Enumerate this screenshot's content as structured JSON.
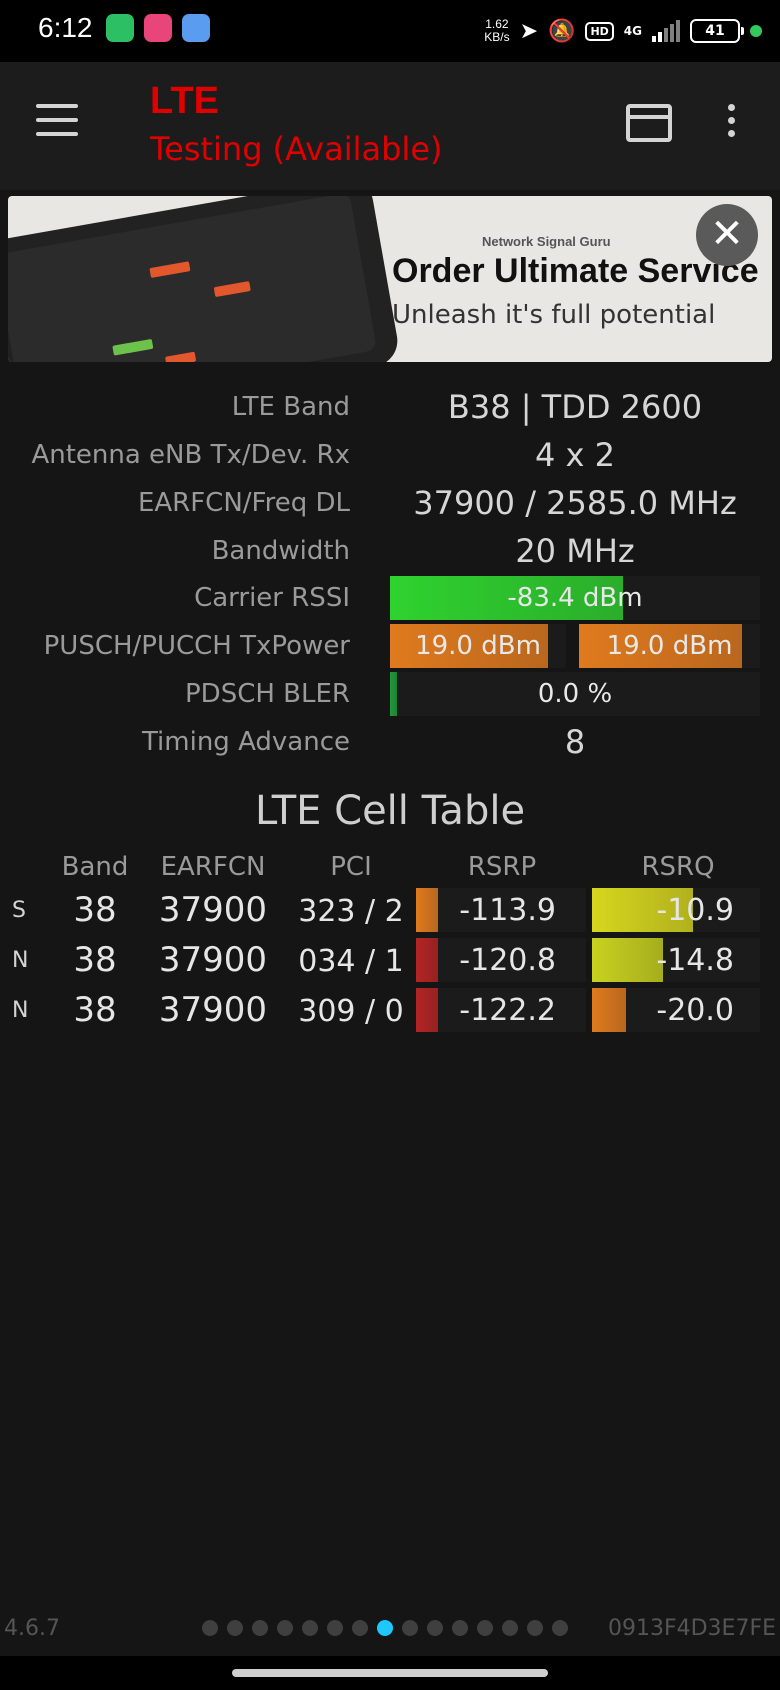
{
  "status_bar": {
    "time": "6:12",
    "speed_value": "1.62",
    "speed_unit": "KB/s",
    "hd": "HD",
    "network": "4G",
    "battery": "41",
    "icons": [
      "location-arrow-icon",
      "bell-off-icon",
      "signal-icon"
    ]
  },
  "app_bar": {
    "title": "LTE",
    "subtitle": "Testing (Available)"
  },
  "ad": {
    "small": "Network Signal Guru",
    "headline": "Order Ultimate Service",
    "tagline": "Unleash it's full potential",
    "close": "✕"
  },
  "info": [
    {
      "label": "LTE Band",
      "value": "B38 | TDD 2600"
    },
    {
      "label": "Antenna eNB Tx/Dev. Rx",
      "value": "4 x 2"
    },
    {
      "label": "EARFCN/Freq DL",
      "value": "37900 / 2585.0 MHz"
    },
    {
      "label": "Bandwidth",
      "value": "20 MHz"
    },
    {
      "label": "Carrier RSSI",
      "value": "-83.4 dBm",
      "level": 0.63,
      "color": "#2fd22f"
    },
    {
      "label": "PUSCH/PUCCH TxPower",
      "value_a": "19.0 dBm",
      "value_b": "19.0 dBm",
      "level_a": 0.9,
      "level_b": 0.9,
      "color": "#e07a1e"
    },
    {
      "label": "PDSCH BLER",
      "value": "0.0 %",
      "level": 0.02,
      "color": "#1f9a3a"
    },
    {
      "label": "Timing Advance",
      "value": "8"
    }
  ],
  "cell_table": {
    "title": "LTE Cell Table",
    "headers": [
      "Band",
      "EARFCN",
      "PCI",
      "RSRP",
      "RSRQ"
    ],
    "rows": [
      {
        "type": "S",
        "band": "38",
        "earfcn": "37900",
        "pci": "323 / 2",
        "rsrp": "-113.9",
        "rsrq": "-10.9",
        "rsrp_level": 0.12,
        "rsrq_level": 0.6,
        "rsrp_color": "#e07a1e",
        "rsrq_color": "#d6d61f"
      },
      {
        "type": "N",
        "band": "38",
        "earfcn": "37900",
        "pci": "034 / 1",
        "rsrp": "-120.8",
        "rsrq": "-14.8",
        "rsrp_level": 0.08,
        "rsrq_level": 0.42,
        "rsrp_color": "#b42424",
        "rsrq_color": "#c8d21f"
      },
      {
        "type": "N",
        "band": "38",
        "earfcn": "37900",
        "pci": "309 / 0",
        "rsrp": "-122.2",
        "rsrq": "-20.0",
        "rsrp_level": 0.07,
        "rsrq_level": 0.2,
        "rsrp_color": "#b42424",
        "rsrq_color": "#e07a1e"
      }
    ]
  },
  "footer": {
    "version": "4.6.7",
    "device_id": "0913F4D3E7FE",
    "page_count": 15,
    "active_page": 7
  }
}
